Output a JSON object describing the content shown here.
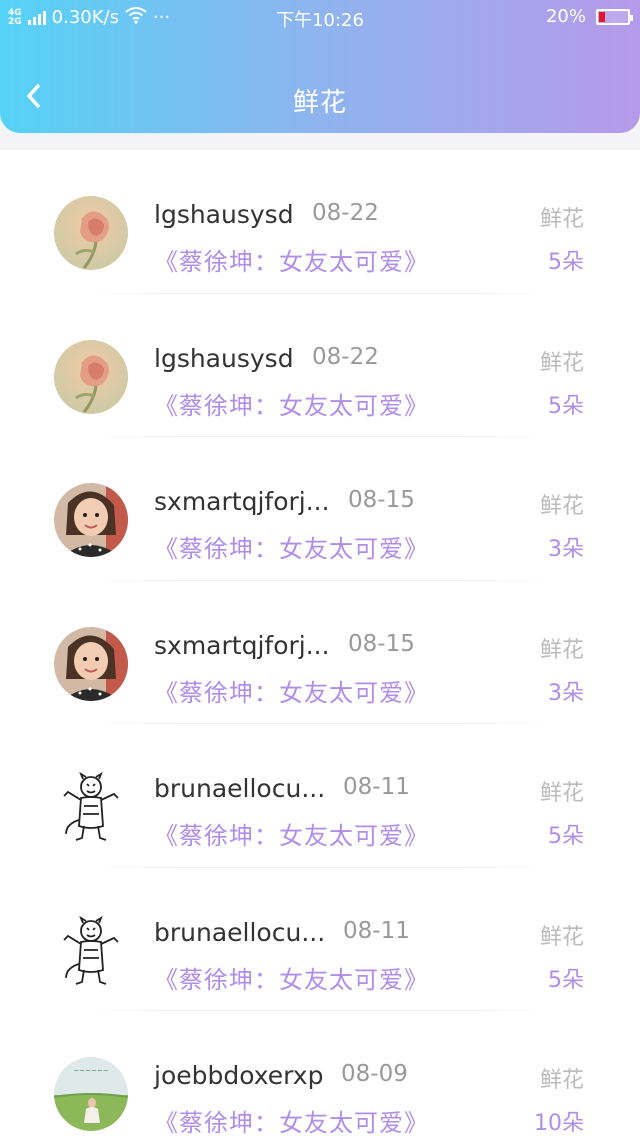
{
  "status_bar": {
    "network": "4G\n2G",
    "speed": "0.30K/s",
    "more": "···",
    "time": "下午10:26",
    "battery": "20%"
  },
  "header": {
    "title": "鲜花"
  },
  "items": [
    {
      "username": "lgshausysd",
      "date": "08-22",
      "gift": "鲜花",
      "work": "《蔡徐坤：女友太可爱》",
      "count": "5朵",
      "avatar": "rose"
    },
    {
      "username": "lgshausysd",
      "date": "08-22",
      "gift": "鲜花",
      "work": "《蔡徐坤：女友太可爱》",
      "count": "5朵",
      "avatar": "rose"
    },
    {
      "username": "sxmartqjforj...",
      "date": "08-15",
      "gift": "鲜花",
      "work": "《蔡徐坤：女友太可爱》",
      "count": "3朵",
      "avatar": "girl"
    },
    {
      "username": "sxmartqjforj...",
      "date": "08-15",
      "gift": "鲜花",
      "work": "《蔡徐坤：女友太可爱》",
      "count": "3朵",
      "avatar": "girl"
    },
    {
      "username": "brunaellocu...",
      "date": "08-11",
      "gift": "鲜花",
      "work": "《蔡徐坤：女友太可爱》",
      "count": "5朵",
      "avatar": "tiger"
    },
    {
      "username": "brunaellocu...",
      "date": "08-11",
      "gift": "鲜花",
      "work": "《蔡徐坤：女友太可爱》",
      "count": "5朵",
      "avatar": "tiger"
    },
    {
      "username": "joebbdoxerxp",
      "date": "08-09",
      "gift": "鲜花",
      "work": "《蔡徐坤：女友太可爱》",
      "count": "10朵",
      "avatar": "field"
    }
  ]
}
